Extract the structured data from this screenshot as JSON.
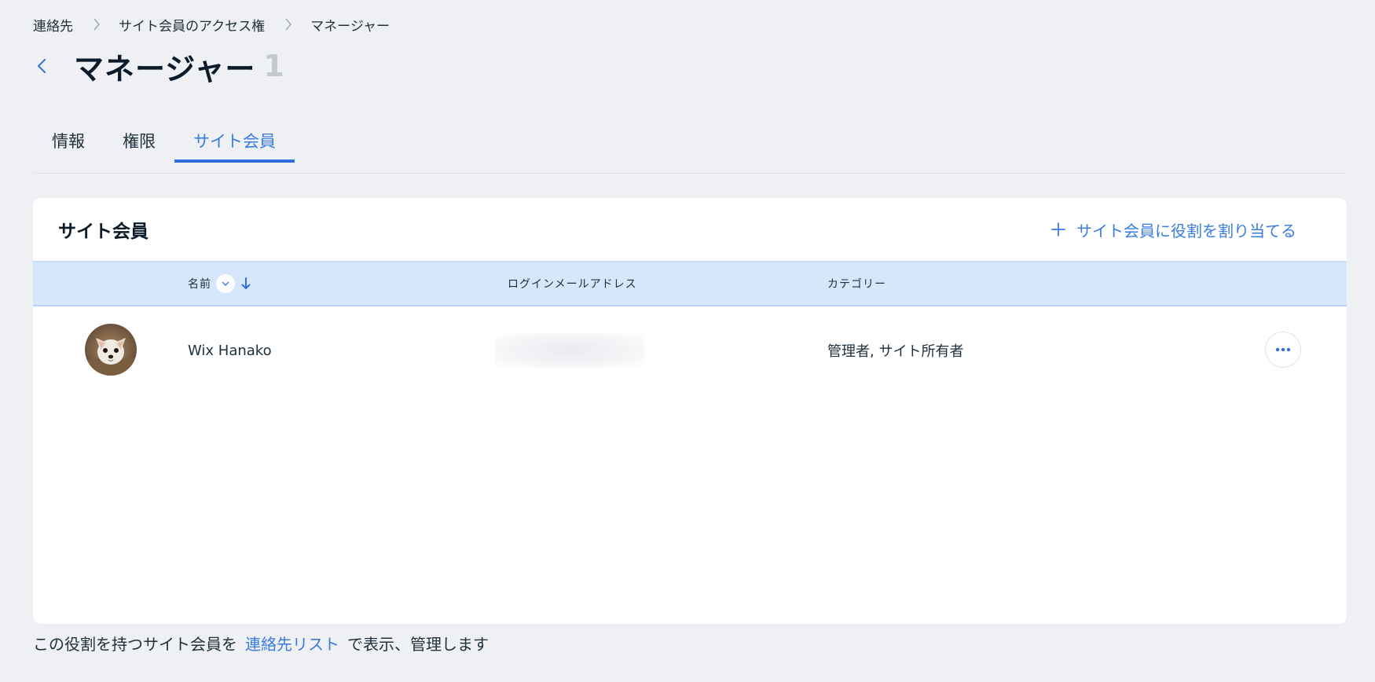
{
  "breadcrumb": {
    "items": [
      "連絡先",
      "サイト会員のアクセス権",
      "マネージャー"
    ]
  },
  "header": {
    "title": "マネージャー",
    "count": "1"
  },
  "tabs": [
    {
      "label": "情報",
      "active": false
    },
    {
      "label": "権限",
      "active": false
    },
    {
      "label": "サイト会員",
      "active": true
    }
  ],
  "card": {
    "title": "サイト会員",
    "assign_label": "サイト会員に役割を割り当てる"
  },
  "table": {
    "columns": [
      "名前",
      "ログインメールアドレス",
      "カテゴリー"
    ],
    "sort": {
      "column": "名前",
      "direction": "descending"
    },
    "rows": [
      {
        "name": "Wix Hanako",
        "email": "",
        "category": "管理者, サイト所有者"
      }
    ]
  },
  "footer": {
    "prefix": "この役割を持つサイト会員を",
    "link": "連絡先リスト",
    "suffix": "で表示、管理します"
  },
  "colors": {
    "accent": "#3b7ce0",
    "background": "#eef0f4",
    "header_row": "#d6e6fc"
  }
}
